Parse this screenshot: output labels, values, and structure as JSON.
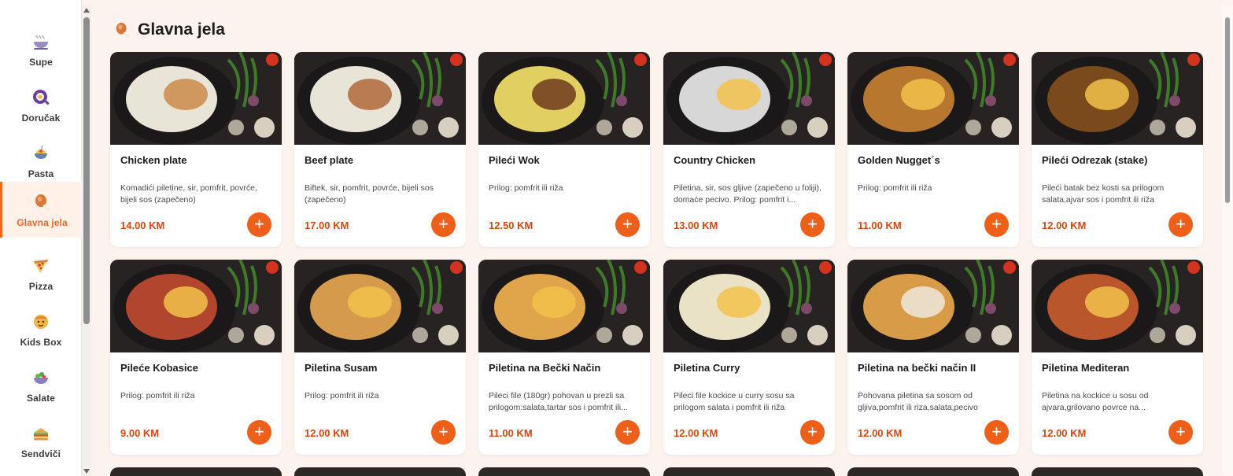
{
  "sidebar": {
    "items": [
      {
        "label": "Supe",
        "icon": "soup-bowl-icon"
      },
      {
        "label": "Doručak",
        "icon": "breakfast-icon"
      },
      {
        "label": "Pasta",
        "icon": "pasta-icon"
      },
      {
        "label": "Glavna jela",
        "icon": "chicken-leg-icon",
        "active": true
      },
      {
        "label": "Pizza",
        "icon": "pizza-slice-icon"
      },
      {
        "label": "Kids Box",
        "icon": "kids-box-icon"
      },
      {
        "label": "Salate",
        "icon": "salad-icon"
      },
      {
        "label": "Sendviči",
        "icon": "sandwich-icon"
      }
    ]
  },
  "section": {
    "title": "Glavna jela",
    "icon": "chicken-leg-icon"
  },
  "items": [
    {
      "name": "Chicken plate",
      "desc": "Komadići piletine, sir, pomfrit, povrće, bijeli sos (zapečeno)",
      "price": "14.00 KM"
    },
    {
      "name": "Beef plate",
      "desc": "Biftek, sir, pomfrit, povrće, bijeli sos (zapečeno)",
      "price": "17.00 KM"
    },
    {
      "name": "Pileći Wok",
      "desc": "Prilog: pomfrit ili riža",
      "price": "12.50 KM"
    },
    {
      "name": "Country Chicken",
      "desc": "Piletina, sir, sos gljive (zapečeno u foliji), domaće pecivo. Prilog: pomfrit i...",
      "price": "13.00 KM"
    },
    {
      "name": "Golden Nugget´s",
      "desc": "Prilog: pomfrit ili riža",
      "price": "11.00 KM"
    },
    {
      "name": "Pileći Odrezak (stake)",
      "desc": "Pileći batak bez kosti sa prilogom salata,ajvar sos i pomfrit ili riža",
      "price": "12.00 KM"
    },
    {
      "name": "Pileće Kobasice",
      "desc": "Prilog: pomfrit ili riža",
      "price": "9.00 KM"
    },
    {
      "name": "Piletina Susam",
      "desc": "Prilog: pomfrit ili riža",
      "price": "12.00 KM"
    },
    {
      "name": "Piletina na Bečki Način",
      "desc": "Pileci file (180gr) pohovan u prezli sa prilogom:salata,tartar sos i pomfrit ili...",
      "price": "11.00 KM"
    },
    {
      "name": "Piletina Curry",
      "desc": "Pileci file kockice u curry sosu sa prilogom salata i pomfrit ili riža",
      "price": "12.00 KM"
    },
    {
      "name": "Piletina na bečki način II",
      "desc": "Pohovana piletina sa sosom od gljiva,pomfrit ili riza,salata,pecivo",
      "price": "12.00 KM"
    },
    {
      "name": "Piletina Mediteran",
      "desc": "Piletina na kockice u sosu od ajvara,grilovano povrce na...",
      "price": "12.00 KM"
    }
  ],
  "add_label": "+",
  "colors": {
    "accent": "#ee5f1a",
    "price": "#d4470f",
    "background": "#fdf3ee",
    "active_bg": "#fff1e8"
  }
}
